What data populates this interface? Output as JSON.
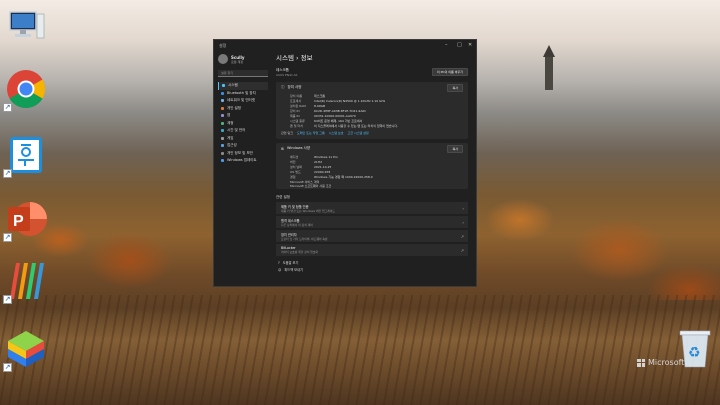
{
  "desktop": {
    "icons": [
      "this-pc",
      "chrome",
      "hangul-word",
      "powerpoint",
      "office-suite",
      "bluestacks"
    ],
    "watermark": "Microsoft"
  },
  "window": {
    "app_title": "설정",
    "user": {
      "name": "Scully",
      "sub": "로컬 계정"
    },
    "search_placeholder": "설정 찾기",
    "nav": [
      {
        "label": "시스템",
        "color": "#4cc2ff"
      },
      {
        "label": "Bluetooth 및 장치",
        "color": "#3a8ee6"
      },
      {
        "label": "네트워크 및 인터넷",
        "color": "#6fb2ee"
      },
      {
        "label": "개인 설정",
        "color": "#d87a3a"
      },
      {
        "label": "앱",
        "color": "#8f8fd8"
      },
      {
        "label": "계정",
        "color": "#4fb37a"
      },
      {
        "label": "시간 및 언어",
        "color": "#3fa6c8"
      },
      {
        "label": "게임",
        "color": "#9a9a9a"
      },
      {
        "label": "접근성",
        "color": "#5aa0e0"
      },
      {
        "label": "개인 정보 및 보안",
        "color": "#8a8a8a"
      },
      {
        "label": "Windows 업데이트",
        "color": "#4c9ae8"
      }
    ],
    "page_title": "시스템 › 정보",
    "device": {
      "name": "데스크톱",
      "sub": "ASUS PN41-S1",
      "rename_btn": "이 PC의 이름 바꾸기"
    },
    "device_spec": {
      "header": "장치 사양",
      "copy_btn": "복사",
      "rows": [
        {
          "key": "장치 이름",
          "val": "데스크톱"
        },
        {
          "key": "프로세서",
          "val": "Intel(R) Celeron(R) N4500 @ 1.10GHz   1.10 GHz"
        },
        {
          "key": "설치된 RAM",
          "val": "8.00GB"
        },
        {
          "key": "장치 ID",
          "val": "6C2D-4E8F-A93B-8F1E-7D21-9A0C"
        },
        {
          "key": "제품 ID",
          "val": "00331-10000-00001-AA970"
        },
        {
          "key": "시스템 종류",
          "val": "64비트 운영 체제, x64 기반 프로세서"
        },
        {
          "key": "펜 및 터치",
          "val": "이 디스플레이에서 사용할 수 있는 펜 또는 터치식 입력이 없습니다."
        }
      ],
      "links_label": "관련 링크",
      "links": [
        "도메인 또는 작업 그룹",
        "시스템 보호",
        "고급 시스템 설정"
      ]
    },
    "windows_spec": {
      "header": "Windows 사양",
      "copy_btn": "복사",
      "rows": [
        {
          "key": "에디션",
          "val": "Windows 11 Pro"
        },
        {
          "key": "버전",
          "val": "21H2"
        },
        {
          "key": "설치 날짜",
          "val": "2021-10-25"
        },
        {
          "key": "OS 빌드",
          "val": "22000.258"
        },
        {
          "key": "경험",
          "val": "Windows 기능 경험 팩 1000.22000.258.0"
        }
      ],
      "extra": [
        "Microsoft 서비스 계약",
        "Microsoft 소프트웨어 사용 조건"
      ]
    },
    "related": {
      "title": "관련 설정",
      "items": [
        {
          "title": "제품 키 및 정품 인증",
          "sub": "제품 키 변경 또는 Windows 버전 업그레이드"
        },
        {
          "title": "원격 데스크톱",
          "sub": "다른 장치에서 이 장치 제어"
        },
        {
          "title": "장치 관리자",
          "sub": "프린터 및 기타 드라이버, 하드웨어 속성"
        },
        {
          "title": "BitLocker",
          "sub": "데이터 보호를 위한 장치 암호화"
        }
      ]
    },
    "footer": [
      "도움말 보기",
      "피드백 보내기"
    ]
  }
}
